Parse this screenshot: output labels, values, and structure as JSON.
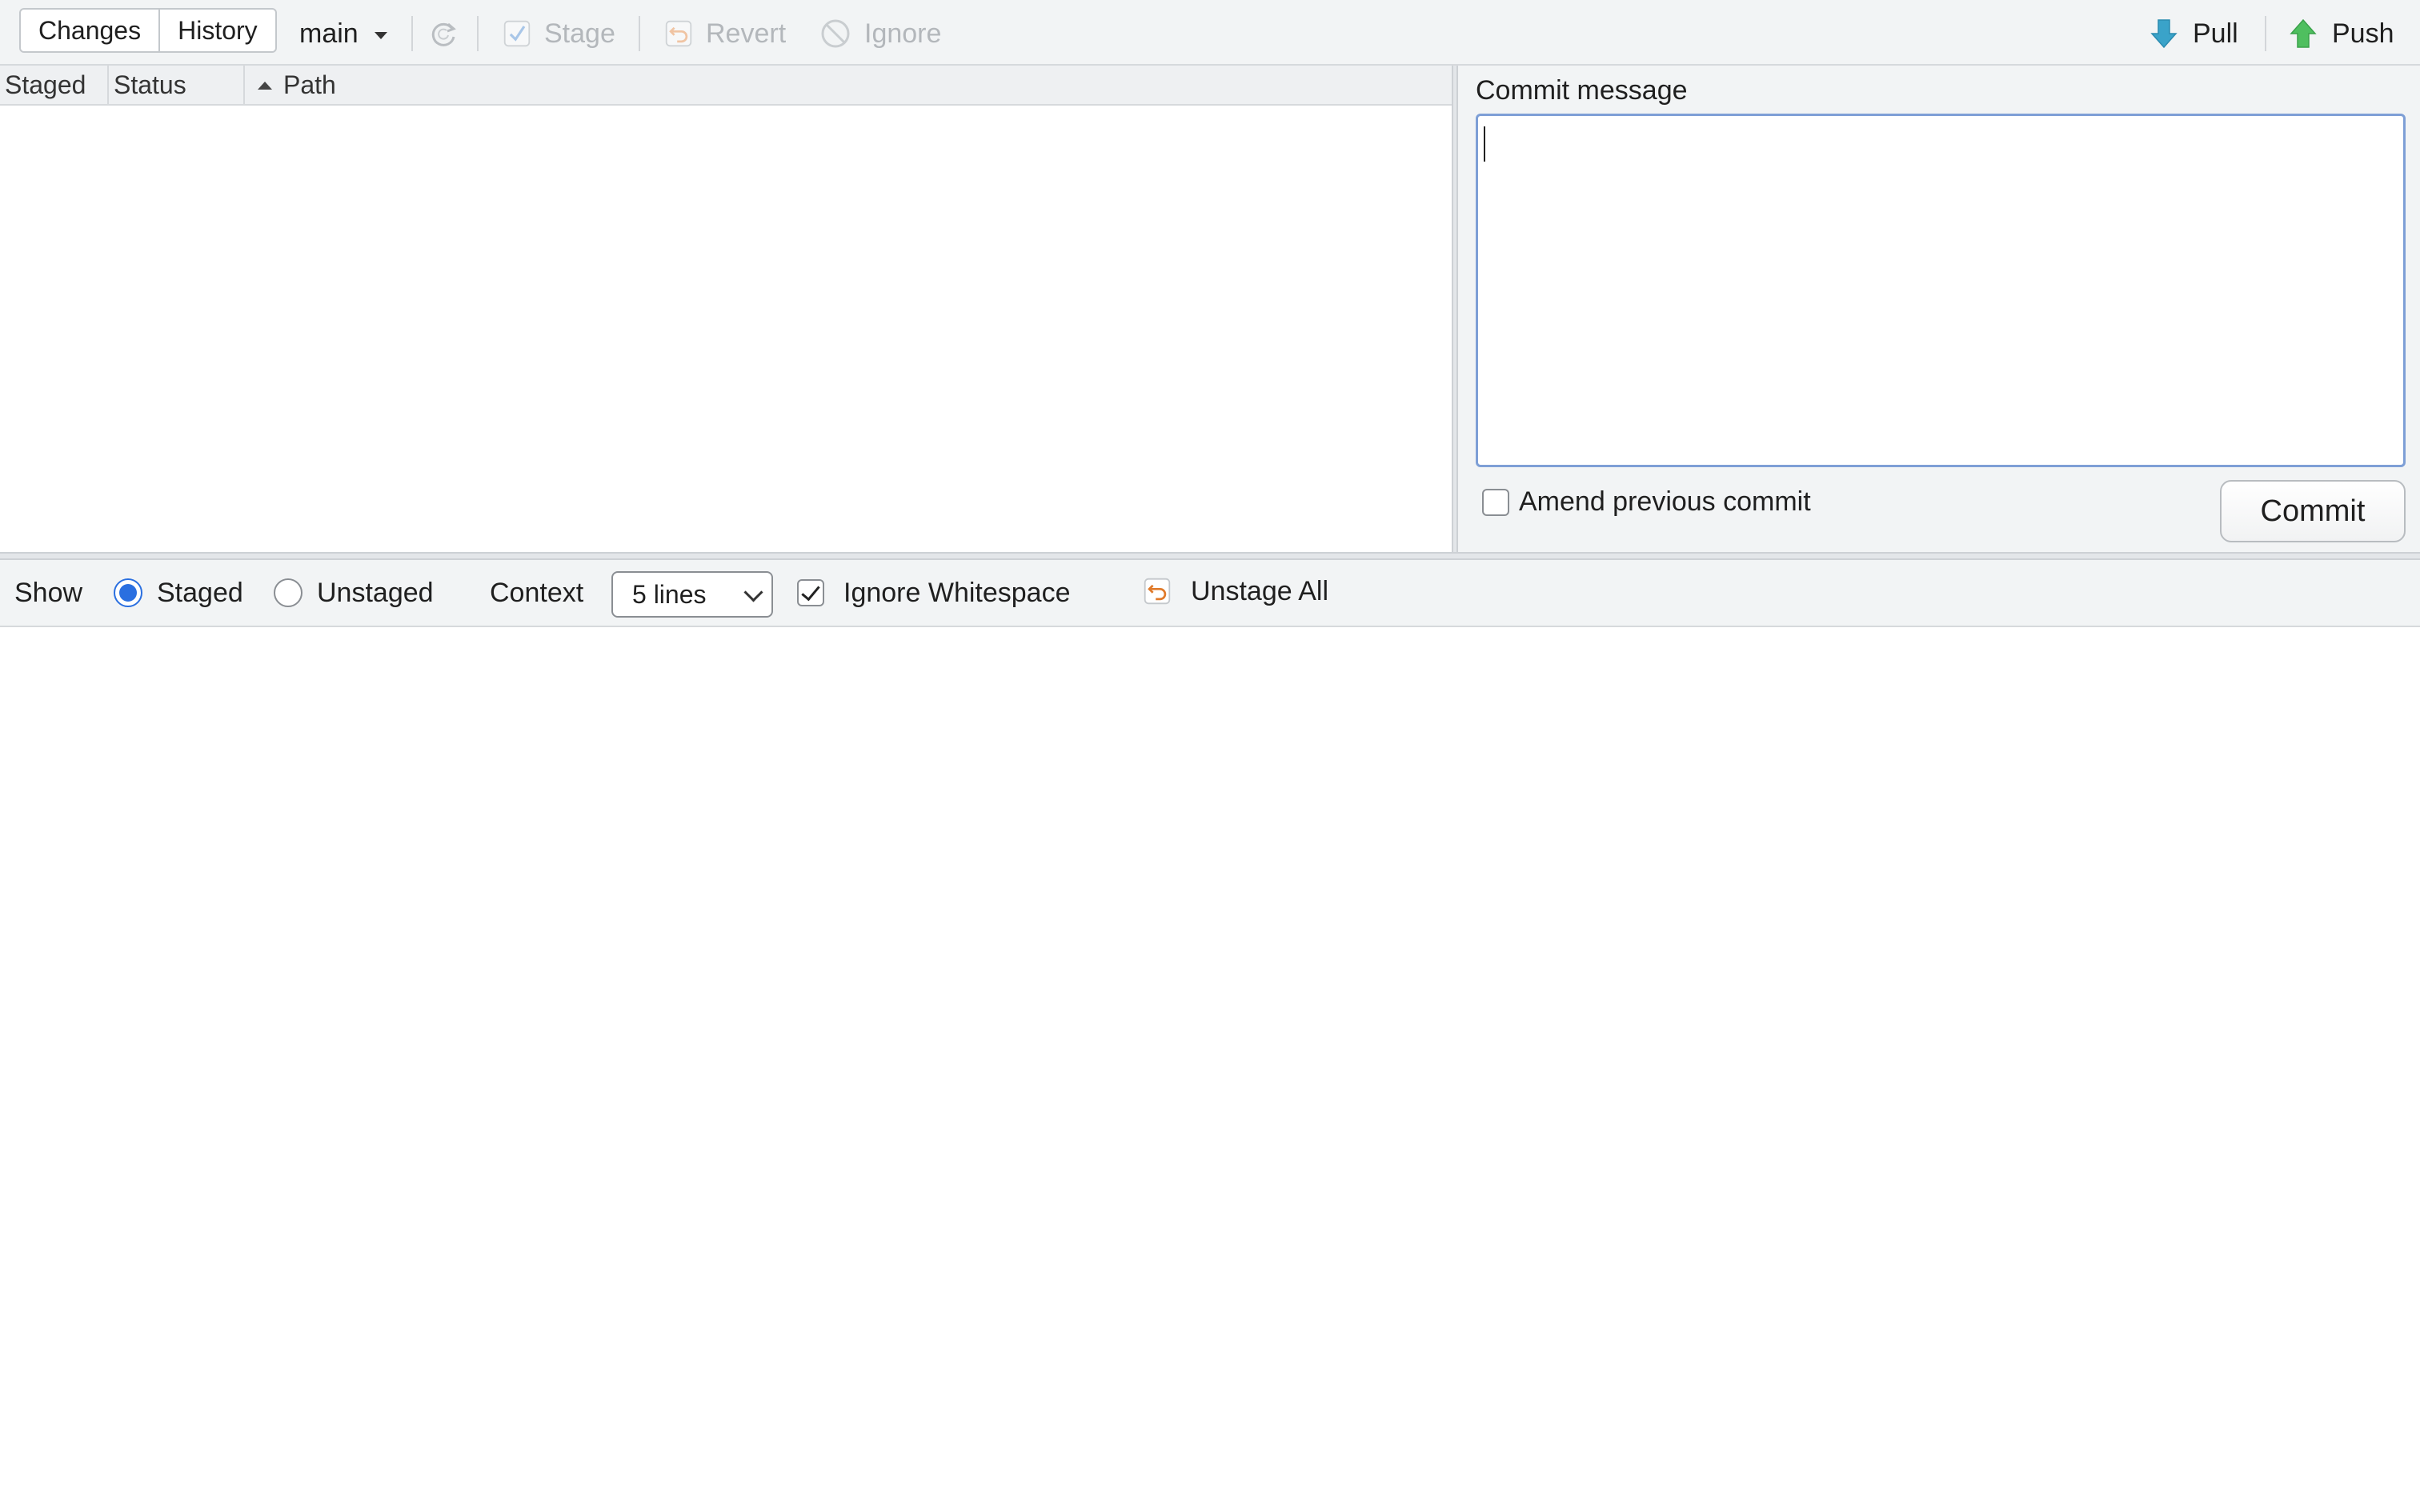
{
  "toolbar": {
    "tabs": [
      {
        "label": "Changes",
        "selected": true
      },
      {
        "label": "History",
        "selected": false
      }
    ],
    "branch": "main",
    "refresh_icon": "refresh-icon",
    "stage_label": "Stage",
    "revert_label": "Revert",
    "ignore_label": "Ignore",
    "pull_label": "Pull",
    "push_label": "Push"
  },
  "file_list": {
    "columns": [
      "Staged",
      "Status",
      "Path"
    ],
    "sort_column": "Path",
    "sort_direction": "ascending",
    "rows": []
  },
  "commit": {
    "label": "Commit message",
    "message": "",
    "amend_label": "Amend previous commit",
    "amend_checked": false,
    "button_label": "Commit"
  },
  "diff_toolbar": {
    "show_label": "Show",
    "staged_label": "Staged",
    "unstaged_label": "Unstaged",
    "show_selected": "Staged",
    "context_label": "Context",
    "context_value": "5 lines",
    "ignore_ws_label": "Ignore Whitespace",
    "ignore_ws_checked": true,
    "unstage_all_label": "Unstage All"
  },
  "colors": {
    "accent": "#2a6fe0",
    "pull_icon": "#3aa3c9",
    "push_icon": "#4fbf5f",
    "revert_icon": "#e07a2a",
    "disabled_text": "#b3b7bb"
  }
}
